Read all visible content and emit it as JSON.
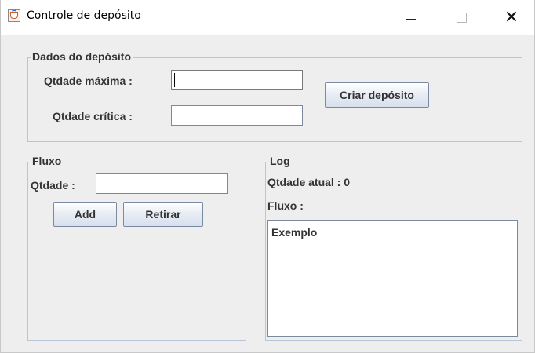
{
  "window": {
    "title": "Controle de depósito",
    "minimize_glyph": "",
    "maximize_glyph": "",
    "close_glyph": "✕"
  },
  "deposito": {
    "legend": "Dados do depósito",
    "max_label": "Qtdade máxima :",
    "max_value": "",
    "crit_label": "Qtdade crítica :",
    "crit_value": "",
    "create_button": "Criar depósito"
  },
  "fluxo": {
    "legend": "Fluxo",
    "qty_label": "Qtdade :",
    "qty_value": "",
    "add_button": "Add",
    "remove_button": "Retirar"
  },
  "log": {
    "legend": "Log",
    "current_label": "Qtdade atual :",
    "current_value": "0",
    "flow_label": "Fluxo :",
    "flow_text": "Exemplo"
  }
}
